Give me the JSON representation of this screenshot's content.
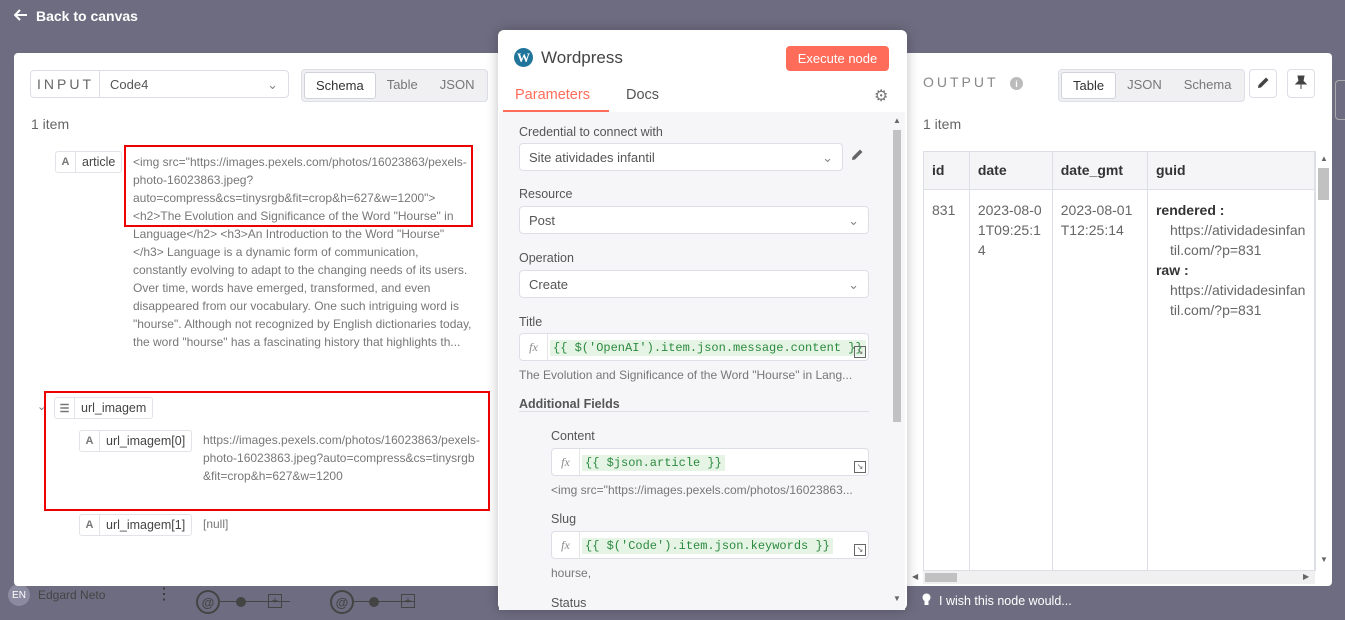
{
  "nav": {
    "back_label": "Back to canvas",
    "logo": "n8n"
  },
  "user": {
    "initials": "EN",
    "name": "Edgard Neto",
    "menu": "⋮"
  },
  "input": {
    "title": "INPUT",
    "source_node": "Code4",
    "views": [
      "Schema",
      "Table",
      "JSON"
    ],
    "active_view": "Schema",
    "count": "1 item",
    "fields": {
      "article_type": "A",
      "article_name": "article",
      "article_value": "<img src=\"https://images.pexels.com/photos/16023863/pexels-photo-16023863.jpeg?auto=compress&cs=tinysrgb&fit=crop&h=627&w=1200\"> <h2>The Evolution and Significance of the Word \"Hourse\" in Language</h2> <h3>An Introduction to the Word \"Hourse\"</h3> Language is a dynamic form of communication, constantly evolving to adapt to the changing needs of its users. Over time, words have emerged, transformed, and even disappeared from our vocabulary. One such intriguing word is \"hourse\". Although not recognized by English dictionaries today, the word \"hourse\" has a fascinating history that highlights th...",
      "url_type": "☰",
      "url_name": "url_imagem",
      "url0_type": "A",
      "url0_name": "url_imagem[0]",
      "url0_value": "https://images.pexels.com/photos/16023863/pexels-photo-16023863.jpeg?auto=compress&cs=tinysrgb&fit=crop&h=627&w=1200",
      "url1_type": "A",
      "url1_name": "url_imagem[1]",
      "url1_value": "[null]"
    }
  },
  "node": {
    "icon": "W",
    "title": "Wordpress",
    "execute_label": "Execute node",
    "tabs": {
      "parameters": "Parameters",
      "docs": "Docs"
    },
    "credential_label": "Credential to connect with",
    "credential_value": "Site atividades infantil",
    "resource_label": "Resource",
    "resource_value": "Post",
    "operation_label": "Operation",
    "operation_value": "Create",
    "title_label": "Title",
    "title_expr": "{{ $('OpenAI').item.json.message.content }}",
    "title_hint": "The Evolution and Significance of the Word \"Hourse\" in Lang...",
    "additional_label": "Additional Fields",
    "content_label": "Content",
    "content_expr": "{{ $json.article }}",
    "content_hint": "<img src=\"https://images.pexels.com/photos/16023863...",
    "slug_label": "Slug",
    "slug_expr": "{{ $('Code').item.json.keywords }}",
    "slug_hint": "hourse,",
    "status_label": "Status",
    "fx": "fx"
  },
  "output": {
    "title": "OUTPUT",
    "views": [
      "Table",
      "JSON",
      "Schema"
    ],
    "active_view": "Table",
    "count": "1 item",
    "columns": [
      "id",
      "date",
      "date_gmt",
      "guid"
    ],
    "row": {
      "id": "831",
      "date": "2023-08-01T09:25:14",
      "date_gmt": "2023-08-01T12:25:14",
      "guid_rendered_key": "rendered :",
      "guid_rendered_val": "https://atividadesinfantil.com/?p=831",
      "guid_raw_key": "raw :",
      "guid_raw_val": "https://atividadesinfantil.com/?p=831"
    }
  },
  "feedback": {
    "label": "I wish this node would..."
  },
  "colors": {
    "accent": "#ff6d5a",
    "wordpress": "#21759b",
    "highlight": "#ee0000"
  }
}
